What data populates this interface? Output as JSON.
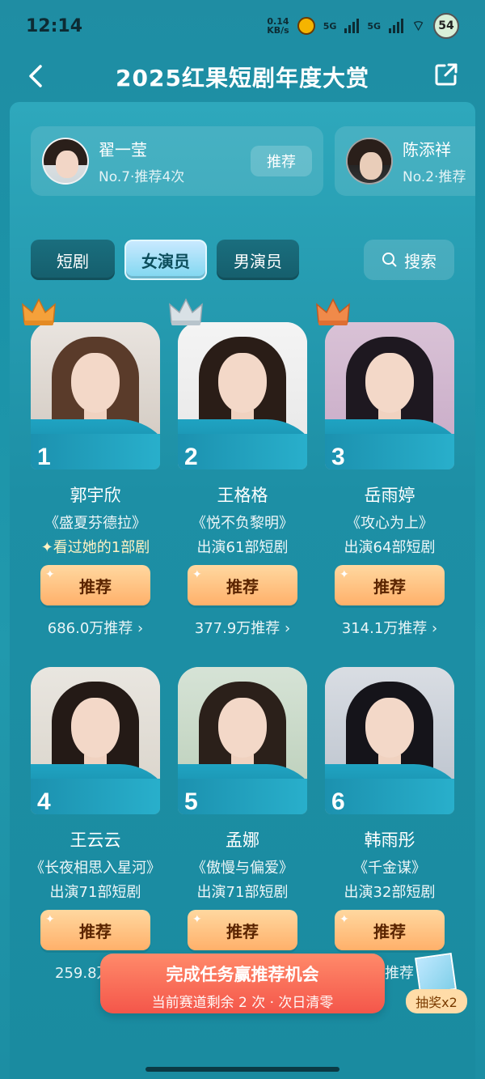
{
  "status": {
    "time": "12:14",
    "speed_value": "0.14",
    "speed_unit": "KB/s",
    "network1": "5G",
    "network2": "5G",
    "battery": "54"
  },
  "header": {
    "title": "2025红果短剧年度大赏"
  },
  "recommended": [
    {
      "name": "翟一莹",
      "sub": "No.7·推荐4次",
      "button": "推荐"
    },
    {
      "name": "陈添祥",
      "sub": "No.2·推荐"
    }
  ],
  "tabs": [
    {
      "label": "短剧"
    },
    {
      "label": "女演员"
    },
    {
      "label": "男演员"
    }
  ],
  "search": {
    "label": "搜索"
  },
  "actresses": [
    {
      "rank": "1",
      "name": "郭宇欣",
      "drama": "《盛夏芬德拉》",
      "sub": "✦看过她的1部剧",
      "button": "推荐",
      "votes": "686.0万推荐 ›"
    },
    {
      "rank": "2",
      "name": "王格格",
      "drama": "《悦不负黎明》",
      "sub": "出演61部短剧",
      "button": "推荐",
      "votes": "377.9万推荐 ›"
    },
    {
      "rank": "3",
      "name": "岳雨婷",
      "drama": "《攻心为上》",
      "sub": "出演64部短剧",
      "button": "推荐",
      "votes": "314.1万推荐 ›"
    },
    {
      "rank": "4",
      "name": "王云云",
      "drama": "《长夜相思入星河》",
      "sub": "出演71部短剧",
      "button": "推荐",
      "votes": "259.8万"
    },
    {
      "rank": "5",
      "name": "孟娜",
      "drama": "《傲慢与偏爱》",
      "sub": "出演71部短剧",
      "button": "推荐",
      "votes": ""
    },
    {
      "rank": "6",
      "name": "韩雨彤",
      "drama": "《千金谋》",
      "sub": "出演32部短剧",
      "button": "推荐",
      "votes": "万推荐"
    }
  ],
  "promo": {
    "title": "完成任务赢推荐机会",
    "subtitle": "当前赛道剩余 2 次 · 次日清零"
  },
  "lottery": {
    "label": "抽奖x2"
  },
  "colors": {
    "accent": "#1b93a8",
    "button": "#ffb06a",
    "promo": "#f4564a",
    "crown_gold": "#f5a13a",
    "crown_silver": "#c9d3da"
  }
}
